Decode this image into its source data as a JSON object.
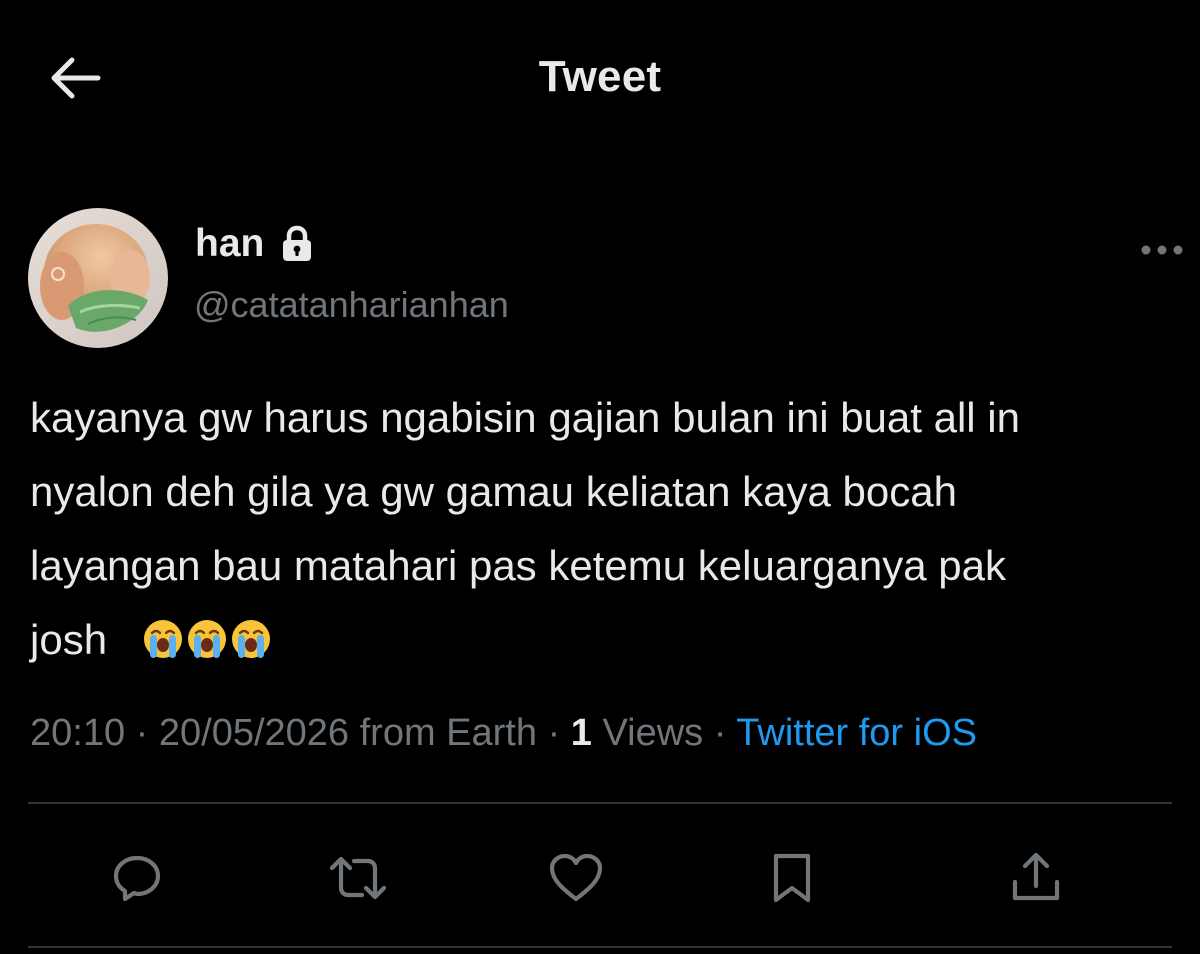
{
  "header": {
    "title": "Tweet"
  },
  "author": {
    "display_name": "han",
    "handle": "@catatanharianhan"
  },
  "tweet": {
    "text_lines": [
      "kayanya gw harus ngabisin gajian bulan ini buat all in",
      "nyalon deh gila ya gw gamau keliatan kaya bocah",
      "layangan bau matahari pas ketemu keluarganya pak",
      "josh"
    ],
    "emoji_names": [
      "loudly-crying-face",
      "loudly-crying-face",
      "loudly-crying-face"
    ]
  },
  "meta": {
    "time": "20:10",
    "sep1": " · ",
    "date": "20/05/2026",
    "location": " from Earth",
    "sep2": " · ",
    "views_count": "1",
    "views_label": " Views",
    "sep3": " · ",
    "source": "Twitter for iOS"
  },
  "colors": {
    "background": "#000000",
    "primary_text": "#e7e9ea",
    "secondary_text": "#71767b",
    "link": "#1d9bf0",
    "divider": "#2f3336"
  },
  "icons": {
    "back": "arrow-left-icon",
    "lock": "lock-icon",
    "more": "more-horizontal-icon",
    "reply": "reply-icon",
    "retweet": "retweet-icon",
    "like": "heart-icon",
    "bookmark": "bookmark-icon",
    "share": "share-icon"
  }
}
